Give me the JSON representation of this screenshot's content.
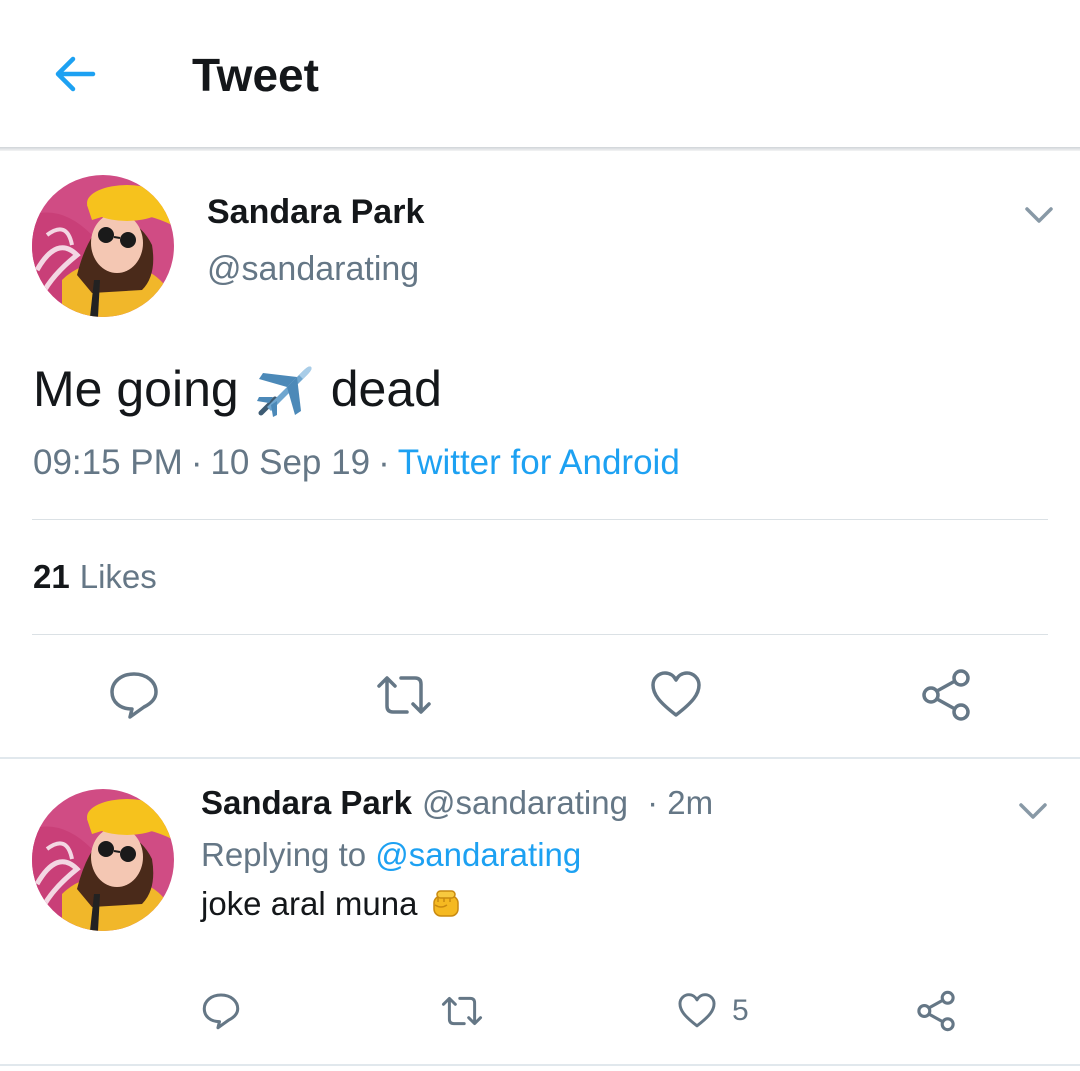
{
  "header": {
    "title": "Tweet",
    "back_icon": "arrow-left-icon"
  },
  "tweet": {
    "author_name": "Sandara Park",
    "author_handle": "@sandarating",
    "text_before": "Me going",
    "text_after": "dead",
    "emoji": "airplane-emoji",
    "time": "09:15 PM",
    "date": "10 Sep 19",
    "separator": "·",
    "source": "Twitter for Android",
    "likes_count": "21",
    "likes_label": "Likes"
  },
  "reply": {
    "author_name": "Sandara Park",
    "author_handle": "@sandarating",
    "time_ago": "· 2m",
    "replying_prefix": "Replying to",
    "replying_to": "@sandarating",
    "text": "joke aral muna",
    "emoji": "raised-fist-emoji",
    "like_count": "5"
  },
  "colors": {
    "accent": "#1da1f2",
    "text_primary": "#14171a",
    "text_secondary": "#657786",
    "icon_gray": "#657786",
    "divider": "#dbe1e5"
  }
}
